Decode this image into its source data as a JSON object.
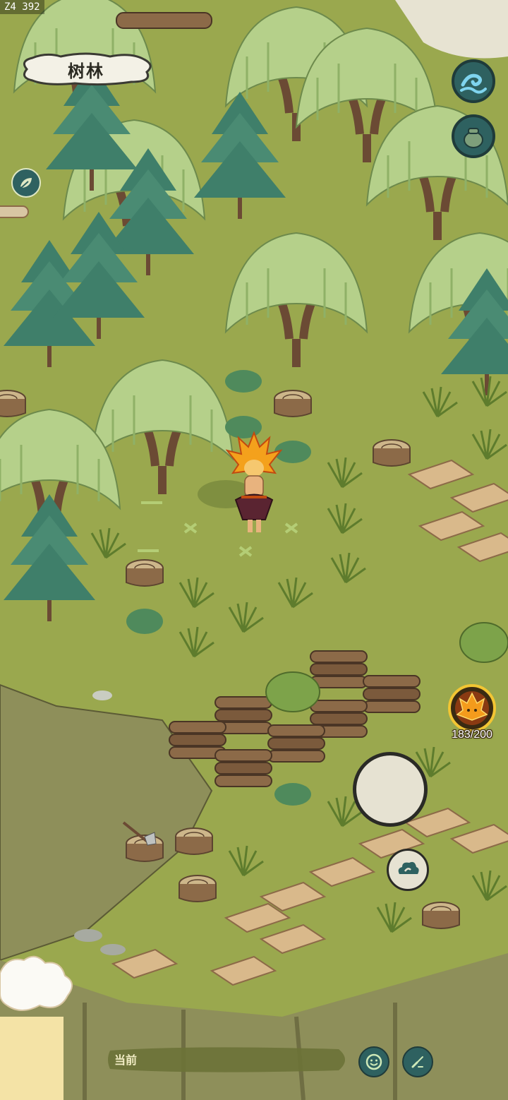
{
  "debug": {
    "id_text": "Z4 392"
  },
  "location": {
    "name": "树林"
  },
  "energy": {
    "count": "183/200"
  },
  "chat": {
    "label": "当前"
  },
  "icons": {
    "top_right_1": "water-wave-icon",
    "top_right_2": "bag-icon",
    "left_small": "leaf-icon",
    "action_small": "cloud-swirl-icon",
    "emote": "smile-icon",
    "send": "brush-icon",
    "energy": "fire-spirit-icon"
  },
  "colors": {
    "grass": "#9aa84e",
    "cliff": "#8e8f5a",
    "button_teal": "#2e6160",
    "energy_ring": "#f2c533"
  }
}
